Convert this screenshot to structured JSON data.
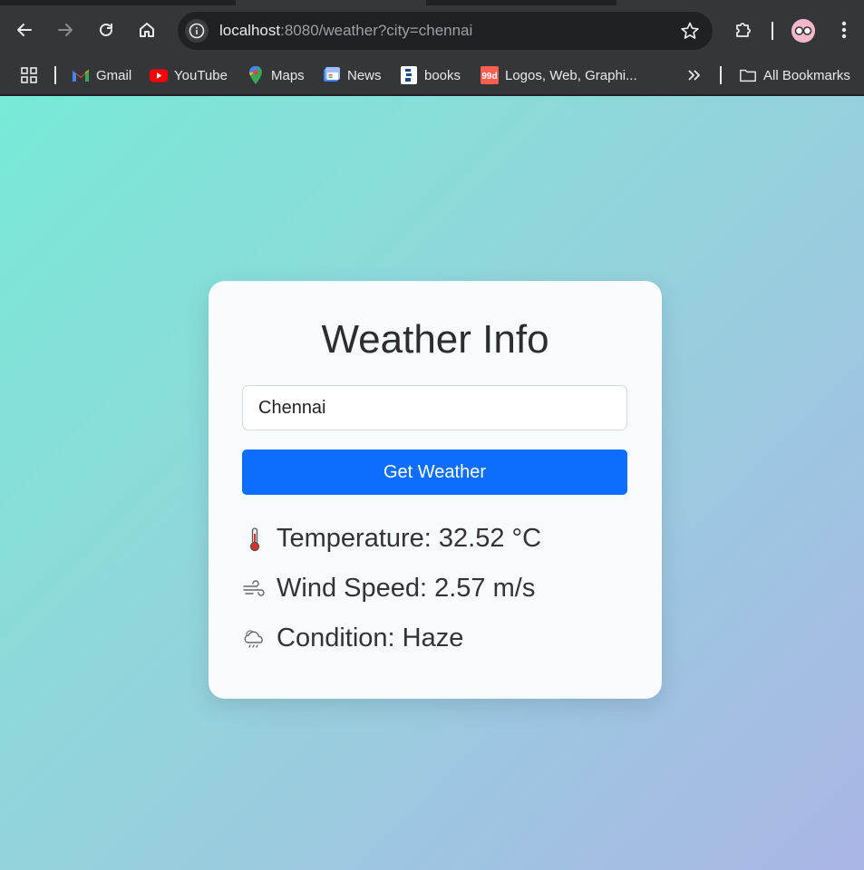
{
  "browser": {
    "url_host": "localhost",
    "url_rest": ":8080/weather?city=chennai"
  },
  "bookmarks": {
    "items": [
      {
        "label": "Gmail"
      },
      {
        "label": "YouTube"
      },
      {
        "label": "Maps"
      },
      {
        "label": "News"
      },
      {
        "label": "books"
      },
      {
        "label": "Logos, Web, Graphi..."
      }
    ],
    "all_bookmarks_label": "All Bookmarks"
  },
  "weather": {
    "title": "Weather Info",
    "city_value": "Chennai",
    "button_label": "Get Weather",
    "temperature_text": "Temperature: 32.52 °C",
    "wind_text": "Wind Speed: 2.57 m/s",
    "condition_text": "Condition: Haze"
  },
  "colors": {
    "accent": "#0d6efd",
    "card": "#f8fbfc",
    "gradient_start": "#78ead7",
    "gradient_end": "#aab5e6"
  }
}
